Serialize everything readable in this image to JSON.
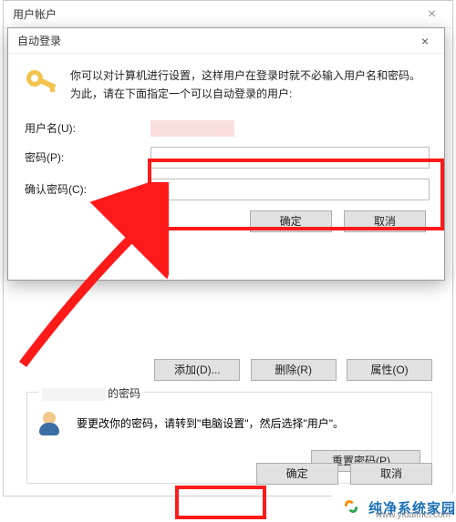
{
  "outerWindow": {
    "title": "用户帐户",
    "close": "×"
  },
  "bgButtons": {
    "add": "添加(D)...",
    "remove": "删除(R)",
    "props": "属性(O)"
  },
  "passwordBox": {
    "titleSuffix": "的密码",
    "msg": "要更改你的密码，请转到\"电脑设置\"，然后选择\"用户\"。",
    "reset": "重置密码(P)..."
  },
  "bottomButtons": {
    "ok": "确定",
    "cancel": "取消"
  },
  "innerDialog": {
    "title": "自动登录",
    "close": "×",
    "info": "你可以对计算机进行设置，这样用户在登录时就不必输入用户名和密码。为此，请在下面指定一个可以自动登录的用户:",
    "labels": {
      "username": "用户名(U):",
      "password": "密码(P):",
      "confirm": "确认密码(C):"
    },
    "ok": "确定",
    "cancel": "取消"
  },
  "watermark": {
    "brand": "纯净系统家园",
    "url": "www.yidaimei.com"
  }
}
